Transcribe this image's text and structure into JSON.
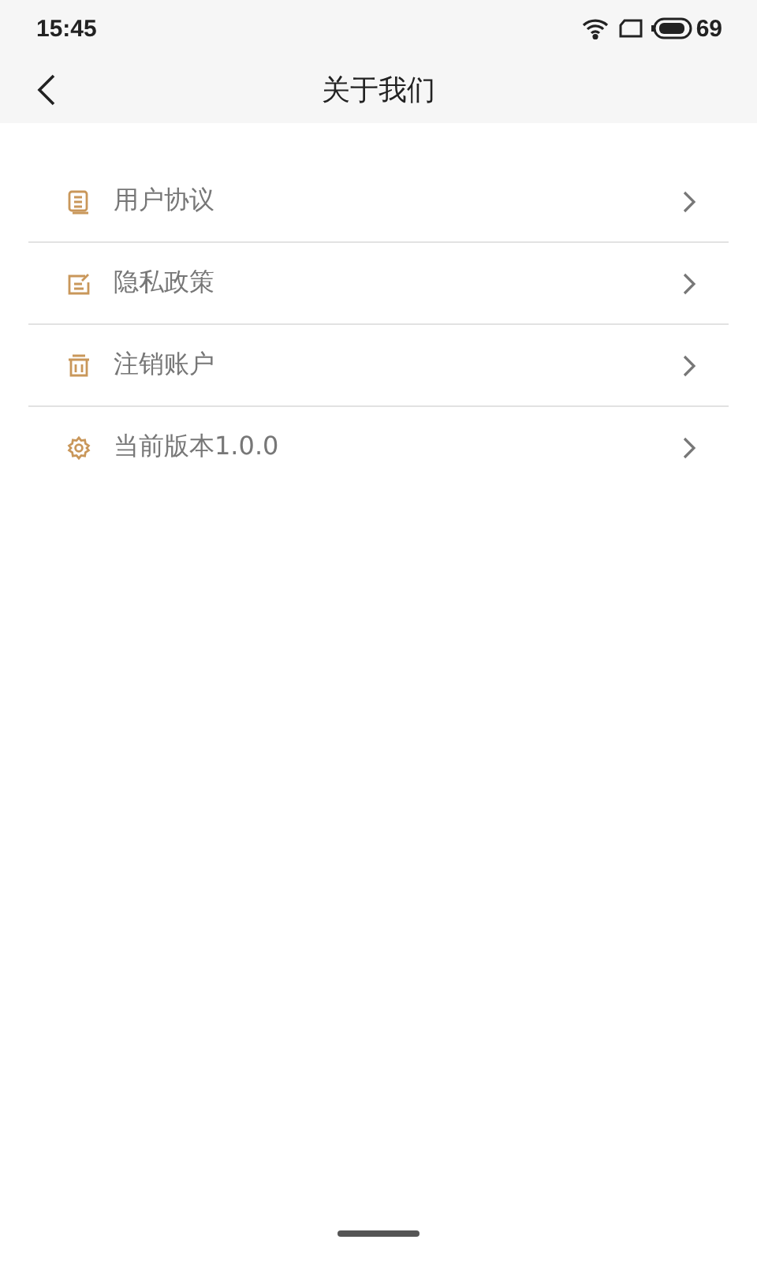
{
  "status_bar": {
    "time": "15:45",
    "battery": "69"
  },
  "header": {
    "title": "关于我们"
  },
  "items": [
    {
      "kind": "document",
      "label": "用户协议"
    },
    {
      "kind": "edit",
      "label": "隐私政策"
    },
    {
      "kind": "trash",
      "label": "注销账户"
    },
    {
      "kind": "gear",
      "label": "当前版本1.0.0"
    }
  ]
}
